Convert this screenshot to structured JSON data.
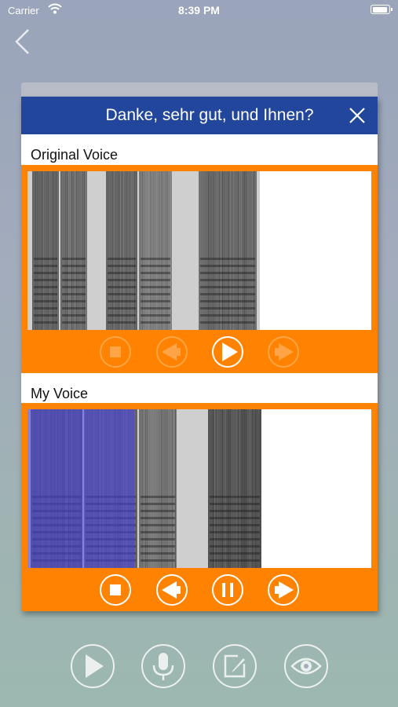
{
  "status": {
    "carrier": "Carrier",
    "time": "8:39 PM"
  },
  "nav": {
    "back_icon": "chevron-left-icon"
  },
  "dialog": {
    "title": "Danke, sehr gut, und Ihnen?",
    "close_icon": "close-icon",
    "original": {
      "label": "Original Voice",
      "controls": [
        {
          "icon": "stop-icon",
          "enabled": false
        },
        {
          "icon": "rewind-icon",
          "enabled": false
        },
        {
          "icon": "play-icon",
          "enabled": true
        },
        {
          "icon": "forward-icon",
          "enabled": false
        }
      ]
    },
    "my_voice": {
      "label": "My Voice",
      "playback_progress": 0.31,
      "controls": [
        {
          "icon": "stop-icon",
          "enabled": true
        },
        {
          "icon": "rewind-icon",
          "enabled": true
        },
        {
          "icon": "pause-icon",
          "enabled": true
        },
        {
          "icon": "forward-icon",
          "enabled": true
        }
      ]
    }
  },
  "bottom_toolbar": [
    "play-icon",
    "microphone-icon",
    "edit-icon",
    "eye-icon"
  ],
  "colors": {
    "header": "#22469c",
    "panel": "#ff8300",
    "highlight": "#4a44f0"
  }
}
